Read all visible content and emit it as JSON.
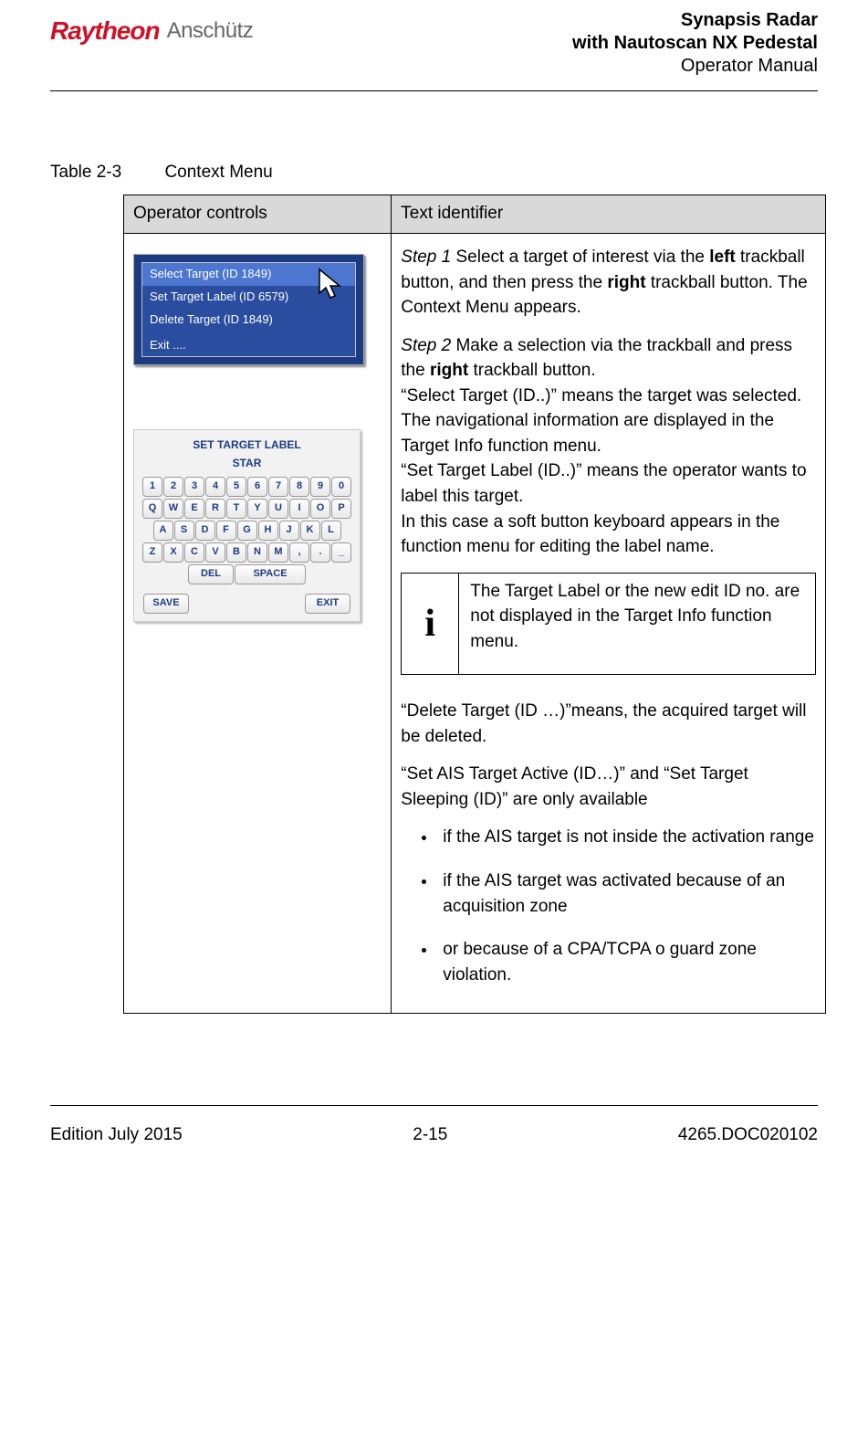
{
  "header": {
    "logo_primary": "Raytheon",
    "logo_secondary": "Anschütz",
    "title1": "Synapsis Radar",
    "title2": "with Nautoscan NX Pedestal",
    "title3": "Operator Manual"
  },
  "body": {
    "table_caption_number": "Table 2-3",
    "table_caption_text": "Context Menu",
    "table_headers": {
      "col1": "Operator controls",
      "col2": "Text identifier"
    },
    "context_menu": {
      "item1": "Select Target (ID 1849)",
      "item2": "Set Target Label (ID 6579)",
      "item3": "Delete Target (ID 1849)",
      "item4": "Exit ...."
    },
    "keyboard": {
      "title": "SET TARGET LABEL",
      "entered": "STAR",
      "row1": [
        "1",
        "2",
        "3",
        "4",
        "5",
        "6",
        "7",
        "8",
        "9",
        "0"
      ],
      "row2": [
        "Q",
        "W",
        "E",
        "R",
        "T",
        "Y",
        "U",
        "I",
        "O",
        "P"
      ],
      "row3": [
        "A",
        "S",
        "D",
        "F",
        "G",
        "H",
        "J",
        "K",
        "L"
      ],
      "row4": [
        "Z",
        "X",
        "C",
        "V",
        "B",
        "N",
        "M",
        ",",
        ".",
        "_"
      ],
      "del": "DEL",
      "space": "SPACE",
      "save": "SAVE",
      "exit": "EXIT"
    },
    "step1_label": "Step 1",
    "step1_a": " Select a target of interest via the ",
    "step1_b": "left",
    "step1_c": " trackball button, and then press the ",
    "step1_d": "right",
    "step1_e": " trackball button. The Context Menu appears.",
    "step2_label": "Step 2",
    "step2_a": " Make a selection via the trackball and press the ",
    "step2_b": "right",
    "step2_c": " trackball button.",
    "select_text": "“Select Target (ID..)” means the target was selected. The navigational information are displayed in the Target Info function menu.",
    "setlabel_text_a": "“Set Target Label (ID..)” means the operator wants to label this target.",
    "setlabel_text_b": "In this case a soft button keyboard appears in the function menu for editing the label name.",
    "info_icon": "i",
    "info_text": "The Target Label or the new edit ID no. are not displayed in the Target Info function menu.",
    "delete_text": "“Delete Target (ID …)”means, the acquired target will be deleted.",
    "ais_intro": "“Set AIS Target Active (ID…)” and “Set Target Sleeping (ID)” are only available",
    "bullet1": "if the AIS target is not inside the activation range",
    "bullet2": "if the AIS target was activated because of an acquisition zone",
    "bullet3": "or because of a CPA/TCPA o guard zone violation."
  },
  "footer": {
    "left": "Edition July 2015",
    "center": "2-15",
    "right": "4265.DOC020102"
  }
}
